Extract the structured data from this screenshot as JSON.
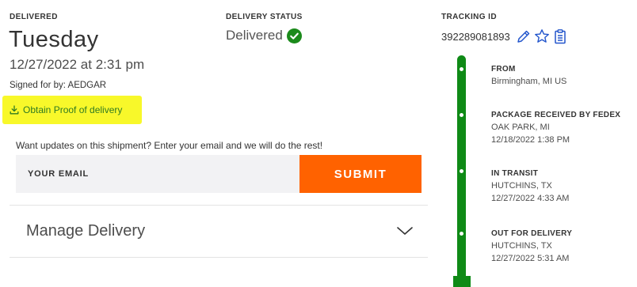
{
  "delivery": {
    "delivered_label": "DELIVERED",
    "day": "Tuesday",
    "datetime": "12/27/2022 at 2:31 pm",
    "signed_for": "Signed for by: AEDGAR",
    "proof_link": "Obtain Proof of delivery",
    "highlight_color": "#f8f82a"
  },
  "status": {
    "label": "DELIVERY STATUS",
    "value": "Delivered",
    "check_color": "#1b8a1b"
  },
  "tracking": {
    "label": "TRACKING ID",
    "number": "392289081893",
    "icons": [
      "pencil-icon",
      "star-icon",
      "clipboard-icon"
    ],
    "icon_color": "#2255cc"
  },
  "updates": {
    "prompt": "Want updates on this shipment? Enter your email and we will do the rest!",
    "email_placeholder": "YOUR EMAIL",
    "submit_label": "SUBMIT",
    "submit_color": "#ff6200"
  },
  "manage": {
    "label": "Manage Delivery",
    "icon": "chevron-down-icon"
  },
  "timeline": {
    "color": "#0f8a16",
    "events": [
      {
        "title": "FROM",
        "line1": "Birmingham, MI US",
        "line2": ""
      },
      {
        "title": "PACKAGE RECEIVED BY FEDEX",
        "line1": "OAK PARK, MI",
        "line2": "12/18/2022 1:38 PM"
      },
      {
        "title": "IN TRANSIT",
        "line1": "HUTCHINS, TX",
        "line2": "12/27/2022 4:33 AM"
      },
      {
        "title": "OUT FOR DELIVERY",
        "line1": "HUTCHINS, TX",
        "line2": "12/27/2022 5:31 AM"
      }
    ]
  }
}
